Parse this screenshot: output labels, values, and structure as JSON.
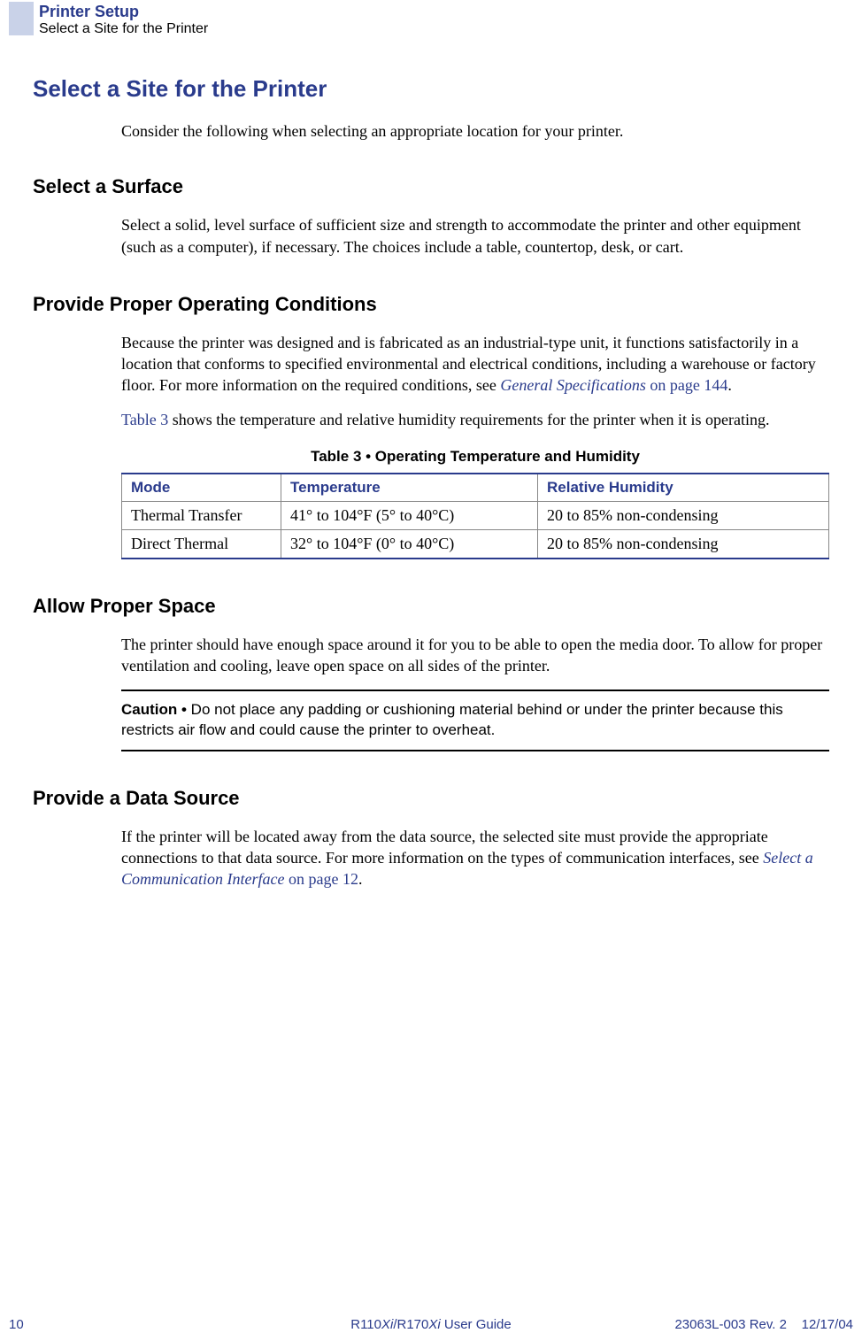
{
  "header": {
    "chapter": "Printer Setup",
    "section": "Select a Site for the Printer"
  },
  "main": {
    "title": "Select a Site for the Printer",
    "intro": "Consider the following when selecting an appropriate location for your printer.",
    "sections": {
      "surface": {
        "heading": "Select a Surface",
        "text": "Select a solid, level surface of sufficient size and strength to accommodate the printer and other equipment (such as a computer), if necessary. The choices include a table, countertop, desk, or cart."
      },
      "conditions": {
        "heading": "Provide Proper Operating Conditions",
        "para1_pre": "Because the printer was designed and is fabricated as an industrial-type unit, it functions satisfactorily in a location that conforms to specified environmental and electrical conditions, including a warehouse or factory floor. For more information on the required conditions, see ",
        "para1_link_italic": "General Specifications",
        "para1_link_plain": " on page 144",
        "para1_post": ".",
        "para2_link": "Table 3",
        "para2_text": " shows the temperature and relative humidity requirements for the printer when it is operating.",
        "table_caption": "Table 3 • Operating Temperature and Humidity",
        "table_headers": {
          "c1": "Mode",
          "c2": "Temperature",
          "c3": "Relative Humidity"
        },
        "table_rows": [
          {
            "c1": "Thermal Transfer",
            "c2": "41° to 104°F (5° to 40°C)",
            "c3": "20 to 85% non-condensing"
          },
          {
            "c1": "Direct Thermal",
            "c2": "32° to 104°F (0° to 40°C)",
            "c3": "20 to 85% non-condensing"
          }
        ]
      },
      "space": {
        "heading": "Allow Proper Space",
        "text": "The printer should have enough space around it for you to be able to open the media door. To allow for proper ventilation and cooling, leave open space on all sides of the printer.",
        "caution_label": "Caution •  ",
        "caution_text": "Do not place any padding or cushioning material behind or under the printer because this restricts air flow and could cause the printer to overheat."
      },
      "data": {
        "heading": "Provide a Data Source",
        "text_pre": "If the printer will be located away from the data source, the selected site must provide the appropriate connections to that data source. For more information on the types of communication interfaces, see ",
        "link_italic": "Select a Communication Interface",
        "link_plain": " on page 12",
        "text_post": "."
      }
    }
  },
  "footer": {
    "page": "10",
    "guide_pre": "R110",
    "guide_it1": "Xi",
    "guide_mid": "/R170",
    "guide_it2": "Xi",
    "guide_post": " User Guide",
    "rev": "23063L-003 Rev. 2",
    "date": "12/17/04"
  }
}
